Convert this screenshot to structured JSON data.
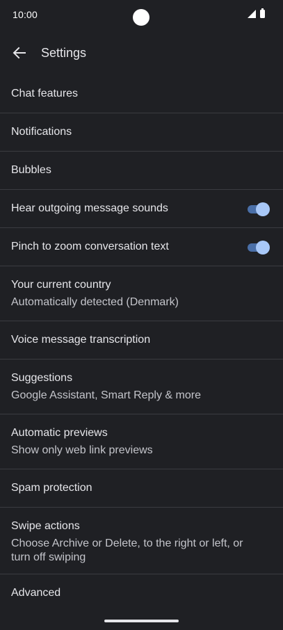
{
  "status_bar": {
    "time": "10:00"
  },
  "app_bar": {
    "title": "Settings",
    "back_icon": "arrow-back-icon"
  },
  "settings": [
    {
      "title": "Chat features",
      "subtitle": ""
    },
    {
      "title": "Notifications",
      "subtitle": ""
    },
    {
      "title": "Bubbles",
      "subtitle": ""
    },
    {
      "title": "Hear outgoing message sounds",
      "subtitle": "",
      "toggle": true
    },
    {
      "title": "Pinch to zoom conversation text",
      "subtitle": "",
      "toggle": true
    },
    {
      "title": "Your current country",
      "subtitle": "Automatically detected (Denmark)"
    },
    {
      "title": "Voice message transcription",
      "subtitle": ""
    },
    {
      "title": "Suggestions",
      "subtitle": "Google Assistant, Smart Reply & more"
    },
    {
      "title": "Automatic previews",
      "subtitle": "Show only web link previews"
    },
    {
      "title": "Spam protection",
      "subtitle": ""
    },
    {
      "title": "Swipe actions",
      "subtitle": "Choose Archive or Delete, to the right or left, or turn off swiping"
    },
    {
      "title": "Advanced",
      "subtitle": ""
    }
  ],
  "colors": {
    "background": "#1f2024",
    "divider": "#3b3c41",
    "toggle_track": "#4a6fa8",
    "toggle_thumb": "#a8c8f8"
  }
}
